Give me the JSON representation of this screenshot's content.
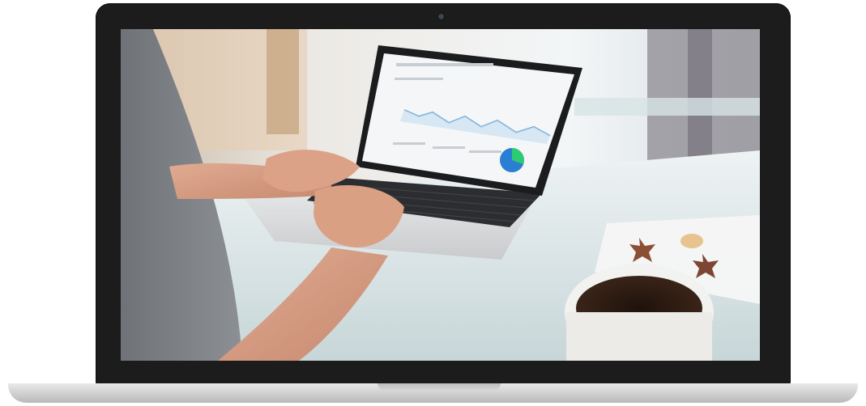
{
  "scene": {
    "subject": "laptop-mockup",
    "photo_subjects": [
      "person-typing",
      "laptop-with-analytics",
      "coffee-cup",
      "star-cookies"
    ],
    "colors": {
      "bezel": "#1c1c1c",
      "base": "#d4d4d4",
      "coffee": "#2a1a12",
      "chart_green": "#2ecc71",
      "chart_blue": "#2a7fd4"
    }
  }
}
